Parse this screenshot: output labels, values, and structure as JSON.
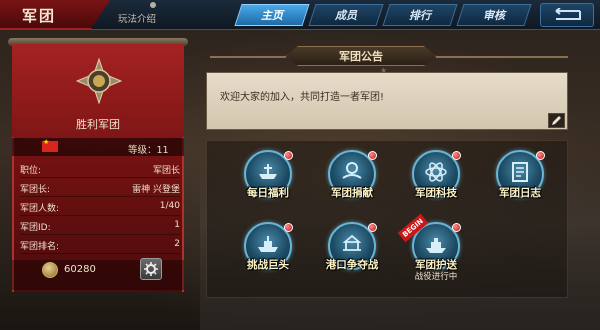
{
  "header": {
    "title": "军团",
    "help_link": "玩法介绍",
    "tabs": [
      {
        "label": "主页",
        "active": true
      },
      {
        "label": "成员",
        "active": false
      },
      {
        "label": "排行",
        "active": false
      },
      {
        "label": "审核",
        "active": false
      }
    ],
    "back_icon": "back-arrow-icon"
  },
  "legion": {
    "name": "胜利军团",
    "flag_icon": "china-flag-icon",
    "level_label": "等级：11",
    "info": [
      {
        "key": "职位:",
        "value": "军团长"
      },
      {
        "key": "军团长:",
        "value": "雷神 兴登堡"
      },
      {
        "key": "军团人数:",
        "value": "1/40"
      },
      {
        "key": "军团ID:",
        "value": "1"
      },
      {
        "key": "军团排名:",
        "value": "2"
      }
    ],
    "coins": "60280",
    "coin_icon": "coin-icon",
    "settings_icon": "gear-icon"
  },
  "notice": {
    "header": "军团公告",
    "text": "欢迎大家的加入，共同打造一者军团!",
    "edit_icon": "pencil-icon"
  },
  "features": [
    {
      "label": "每日福利",
      "icon": "anchor-ship-icon",
      "badge": true,
      "status": ""
    },
    {
      "label": "军团捐献",
      "icon": "donate-hand-icon",
      "badge": true,
      "status": ""
    },
    {
      "label": "军团科技",
      "icon": "atom-icon",
      "badge": true,
      "status": ""
    },
    {
      "label": "军团日志",
      "icon": "log-book-icon",
      "badge": true,
      "status": ""
    },
    {
      "label": "挑战巨头",
      "icon": "warship-icon",
      "badge": true,
      "status": ""
    },
    {
      "label": "港口争夺战",
      "icon": "port-icon",
      "badge": true,
      "status": ""
    },
    {
      "label": "军团护送",
      "icon": "escort-ship-icon",
      "badge": true,
      "status": "战役进行中",
      "ribbon": "BEGIN"
    }
  ],
  "colors": {
    "banner_red": "#8e1b1b",
    "tab_active": "#4aa9e8",
    "tab_inactive": "#1e4566",
    "feature_ring": "#6ab4d4",
    "badge_red": "#c81010"
  }
}
